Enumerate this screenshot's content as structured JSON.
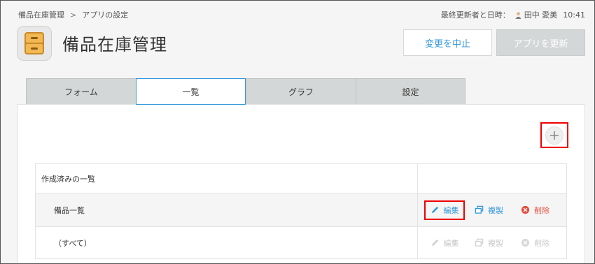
{
  "breadcrumb": {
    "app": "備品在庫管理",
    "separator": ">",
    "page": "アプリの設定"
  },
  "last_update": {
    "label": "最終更新者と日時：",
    "user": "田中 愛美",
    "time": "10:41"
  },
  "app": {
    "title": "備品在庫管理",
    "icon": "drawer-cabinet-icon"
  },
  "buttons": {
    "cancel": "変更を中止",
    "update": "アプリを更新"
  },
  "tabs": [
    {
      "label": "フォーム",
      "active": false
    },
    {
      "label": "一覧",
      "active": true
    },
    {
      "label": "グラフ",
      "active": false
    },
    {
      "label": "設定",
      "active": false
    }
  ],
  "list": {
    "header": "作成済みの一覧",
    "rows": [
      {
        "name": "備品一覧",
        "enabled": true
      },
      {
        "name": "（すべて）",
        "enabled": false
      }
    ],
    "actions": {
      "edit": "編集",
      "copy": "複製",
      "delete": "削除"
    }
  },
  "colors": {
    "accent": "#3498db",
    "danger": "#e74c3c",
    "highlight": "#ee0000"
  }
}
